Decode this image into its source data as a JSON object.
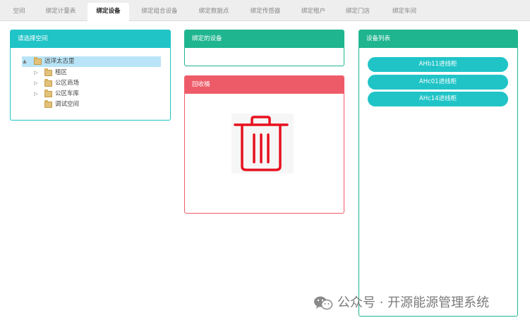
{
  "tabs": [
    {
      "label": "空间",
      "active": false
    },
    {
      "label": "绑定计量表",
      "active": false
    },
    {
      "label": "绑定设备",
      "active": true
    },
    {
      "label": "绑定组合设备",
      "active": false
    },
    {
      "label": "绑定数据点",
      "active": false
    },
    {
      "label": "绑定传感器",
      "active": false
    },
    {
      "label": "绑定租户",
      "active": false
    },
    {
      "label": "绑定门店",
      "active": false
    },
    {
      "label": "绑定车间",
      "active": false
    }
  ],
  "space_panel": {
    "title": "请选择空间",
    "tree": [
      {
        "label": "远洋太古里",
        "expander": "▲",
        "selected": true
      },
      {
        "label": "租区",
        "expander": "▷",
        "selected": false
      },
      {
        "label": "公区商场",
        "expander": "▷",
        "selected": false
      },
      {
        "label": "公区车库",
        "expander": "▷",
        "selected": false
      },
      {
        "label": "调试空间",
        "expander": "",
        "selected": false
      }
    ]
  },
  "bound_panel": {
    "title": "绑定的设备"
  },
  "recycle_panel": {
    "title": "回收桶",
    "icon": "trash-can-icon",
    "icon_color": "#e8101f"
  },
  "device_panel": {
    "title": "设备列表",
    "devices": [
      "AHb11进线柜",
      "AHc01进线柜",
      "AHc14进线柜"
    ]
  },
  "watermark": {
    "text": "公众号 · 开源能源管理系统",
    "icon": "wechat-icon"
  },
  "colors": {
    "cyan": "#20c4c7",
    "green": "#1fb58f",
    "red": "#ee5b68",
    "selected_row": "#b9e4f7"
  }
}
